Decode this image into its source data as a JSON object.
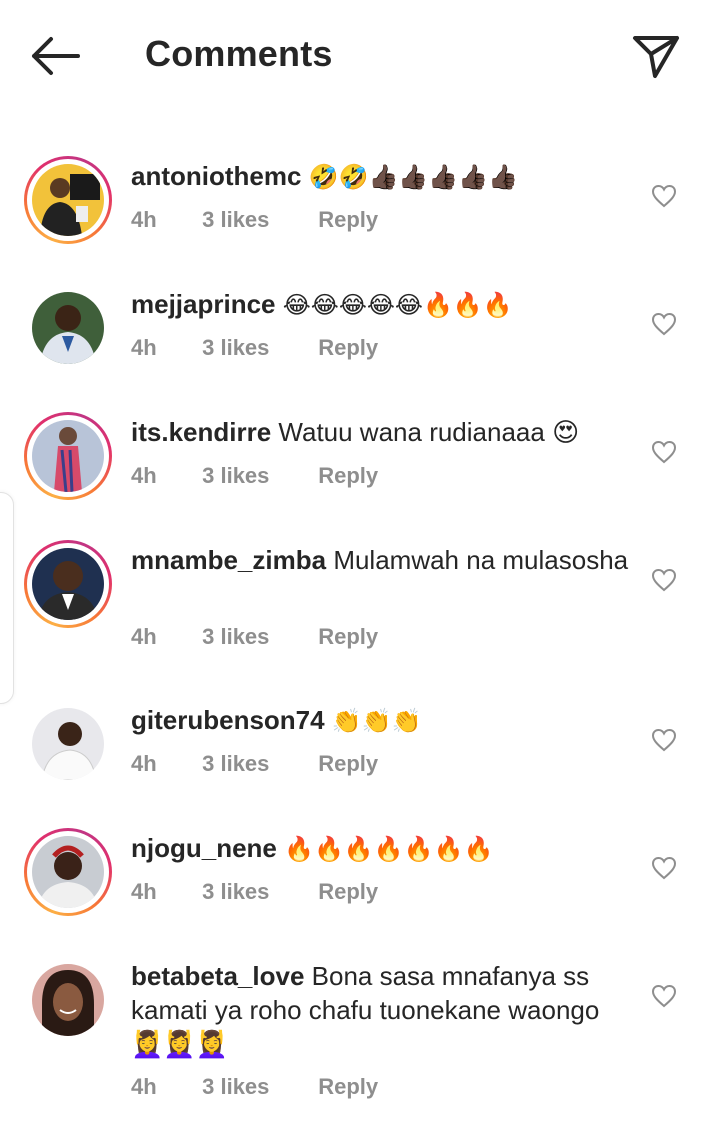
{
  "header": {
    "title": "Comments",
    "back_icon": "arrow-left-icon",
    "send_icon": "send-icon"
  },
  "comments": [
    {
      "username": "antoniothemc",
      "text": "🤣🤣👍🏿👍🏿👍🏿👍🏿👍🏿",
      "time": "4h",
      "likes": "3 likes",
      "reply": "Reply",
      "story_ring": true
    },
    {
      "username": "mejjaprince",
      "text": "😂😂😂😂😂🔥🔥🔥",
      "time": "4h",
      "likes": "3 likes",
      "reply": "Reply",
      "story_ring": false
    },
    {
      "username": "its.kendirre",
      "text": "Watuu wana rudianaaa 😍",
      "time": "4h",
      "likes": "3 likes",
      "reply": "Reply",
      "story_ring": true
    },
    {
      "username": "mnambe_zimba",
      "text": "Mulamwah na mulasosha",
      "time": "4h",
      "likes": "3 likes",
      "reply": "Reply",
      "story_ring": true
    },
    {
      "username": "giterubenson74",
      "text": "👏👏👏",
      "time": "4h",
      "likes": "3 likes",
      "reply": "Reply",
      "story_ring": false
    },
    {
      "username": "njogu_nene",
      "text": "🔥🔥🔥🔥🔥🔥🔥",
      "time": "4h",
      "likes": "3 likes",
      "reply": "Reply",
      "story_ring": true
    },
    {
      "username": "betabeta_love",
      "text": "Bona sasa mnafanya ss kamati ya roho chafu tuonekane waongo 💆‍♀️💆‍♀️💆‍♀️",
      "time": "4h",
      "likes": "3 likes",
      "reply": "Reply",
      "story_ring": false
    }
  ],
  "colors": {
    "text_primary": "#262626",
    "text_secondary": "#8e8e8e",
    "story_ring": [
      "#fcaf45",
      "#e1306c",
      "#c13584"
    ]
  }
}
